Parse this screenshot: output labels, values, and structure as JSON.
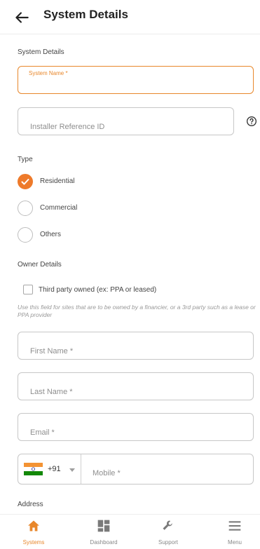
{
  "header": {
    "title": "System Details"
  },
  "system_section": {
    "heading": "System Details",
    "system_name_label": "System Name *",
    "installer_ref_placeholder": "Installer Reference ID"
  },
  "type_section": {
    "heading": "Type",
    "options": [
      {
        "label": "Residential",
        "selected": true
      },
      {
        "label": "Commercial",
        "selected": false
      },
      {
        "label": "Others",
        "selected": false
      }
    ]
  },
  "owner_section": {
    "heading": "Owner Details",
    "third_party_label": "Third party owned (ex: PPA or leased)",
    "third_party_checked": false,
    "helper_text": "Use this field for sites that are to be owned by a financier, or a 3rd party such as a lease or PPA provider",
    "first_name_placeholder": "First Name *",
    "last_name_placeholder": "Last Name *",
    "email_placeholder": "Email *",
    "country_code": "+91",
    "mobile_placeholder": "Mobile *"
  },
  "address_section": {
    "heading": "Address"
  },
  "colors": {
    "accent": "#ee7a2a",
    "text": "#222222",
    "muted": "#8e8e8e"
  },
  "bottom_nav": [
    {
      "label": "Systems",
      "icon": "home-icon",
      "active": true
    },
    {
      "label": "Dashboard",
      "icon": "dashboard-icon",
      "active": false
    },
    {
      "label": "Support",
      "icon": "wrench-icon",
      "active": false
    },
    {
      "label": "Menu",
      "icon": "hamburger-menu-icon",
      "active": false
    }
  ]
}
